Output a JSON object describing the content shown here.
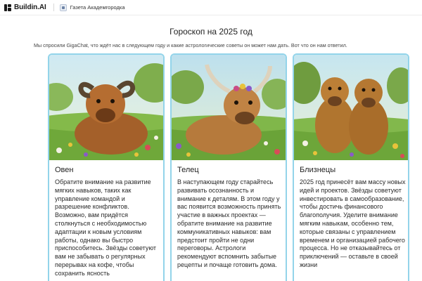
{
  "app": {
    "brand": "Buildin.AI",
    "breadcrumb": "Газета Академгородка"
  },
  "page": {
    "title": "Гороскоп на 2025 год",
    "subtitle": "Мы спросили GigaChat, что ждёт нас в следующем году и какие астрологические советы он может нам дать. Вот что он нам ответил."
  },
  "cards": [
    {
      "name": "Овен",
      "text": "Обратите внимание на развитие мягких навыков, таких как управление командой и разрешение конфликтов. Возможно, вам придётся столкнуться с необходимостью адаптации к новым условиям работы, однако вы быстро приспособитесь. Звёзды советуют вам не забывать о регулярных перерывах на кофе, чтобы сохранить ясность",
      "image": "capybara-with-ram-horns"
    },
    {
      "name": "Телец",
      "text": "В наступающем году старайтесь развивать осознанность и внимание к деталям. В этом году у вас появится возможность принять участие в важных проектах — обратите внимание на развитие коммуникативных навыков: вам предстоит пройти не одни переговоры. Астрологи рекомендуют вспомнить забытые рецепты и почаще готовить дома.",
      "image": "capybara-with-bull-horns"
    },
    {
      "name": "Близнецы",
      "text": "2025 год принесёт вам массу новых идей и проектов. Звёзды советуют инвестировать в самообразование, чтобы достичь финансового благополучия. Уделите внимание мягким навыкам, особенно тем, которые связаны с управлением временем и организацией рабочего процесса. Но не отказывайтесь от приключений — оставьте в своей жизни",
      "image": "two-capybaras"
    }
  ],
  "colors": {
    "card_border": "#93d4ea",
    "sky": "#bfe3ee",
    "grass": "#6fa83a",
    "capybara": "#b06a2c"
  }
}
